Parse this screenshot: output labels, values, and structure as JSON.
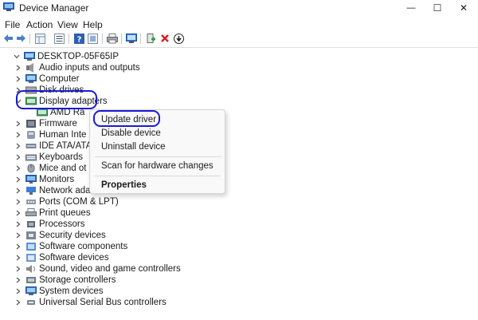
{
  "window": {
    "title": "Device Manager",
    "minimize_glyph": "—",
    "maximize_glyph": "☐",
    "close_glyph": "✕"
  },
  "menu": [
    "File",
    "Action",
    "View",
    "Help"
  ],
  "toolbar_icons": [
    "back-arrow-icon",
    "forward-arrow-icon",
    "properties-grid-icon",
    "device-list-icon",
    "help-icon",
    "show-hidden-icon",
    "print-icon",
    "scan-hardware-icon",
    "monitor-icon",
    "add-driver-icon",
    "uninstall-x-icon",
    "download-update-icon"
  ],
  "tree": {
    "root": "DESKTOP-05F65IP",
    "items": [
      {
        "label": "Audio inputs and outputs",
        "icon": "speaker-icon"
      },
      {
        "label": "Computer",
        "icon": "computer-icon"
      },
      {
        "label": "Disk drives",
        "icon": "disk-icon"
      },
      {
        "label": "Display adapters",
        "icon": "display-adapter-icon",
        "expanded": true
      },
      {
        "label": "AMD Ra",
        "icon": "display-adapter-icon",
        "child": true
      },
      {
        "label": "Firmware",
        "icon": "firmware-icon"
      },
      {
        "label": "Human Inte",
        "icon": "hid-icon"
      },
      {
        "label": "IDE ATA/ATA",
        "icon": "ide-icon"
      },
      {
        "label": "Keyboards",
        "icon": "keyboard-icon"
      },
      {
        "label": "Mice and ot",
        "icon": "mouse-icon"
      },
      {
        "label": "Monitors",
        "icon": "monitor-icon"
      },
      {
        "label": "Network ada",
        "icon": "network-icon"
      },
      {
        "label": "Ports (COM & LPT)",
        "icon": "port-icon"
      },
      {
        "label": "Print queues",
        "icon": "printer-icon"
      },
      {
        "label": "Processors",
        "icon": "processor-icon"
      },
      {
        "label": "Security devices",
        "icon": "security-icon"
      },
      {
        "label": "Software components",
        "icon": "software-component-icon"
      },
      {
        "label": "Software devices",
        "icon": "software-device-icon"
      },
      {
        "label": "Sound, video and game controllers",
        "icon": "sound-icon"
      },
      {
        "label": "Storage controllers",
        "icon": "storage-icon"
      },
      {
        "label": "System devices",
        "icon": "system-icon"
      },
      {
        "label": "Universal Serial Bus controllers",
        "icon": "usb-icon"
      }
    ]
  },
  "context_menu": {
    "update": "Update driver",
    "disable": "Disable device",
    "uninstall": "Uninstall device",
    "scan": "Scan for hardware changes",
    "properties": "Properties"
  },
  "colors": {
    "highlight": "#1b1bd6",
    "accent_blue": "#1f6fd1",
    "remove_red": "#d81e1e",
    "add_green": "#2a9d3a"
  }
}
